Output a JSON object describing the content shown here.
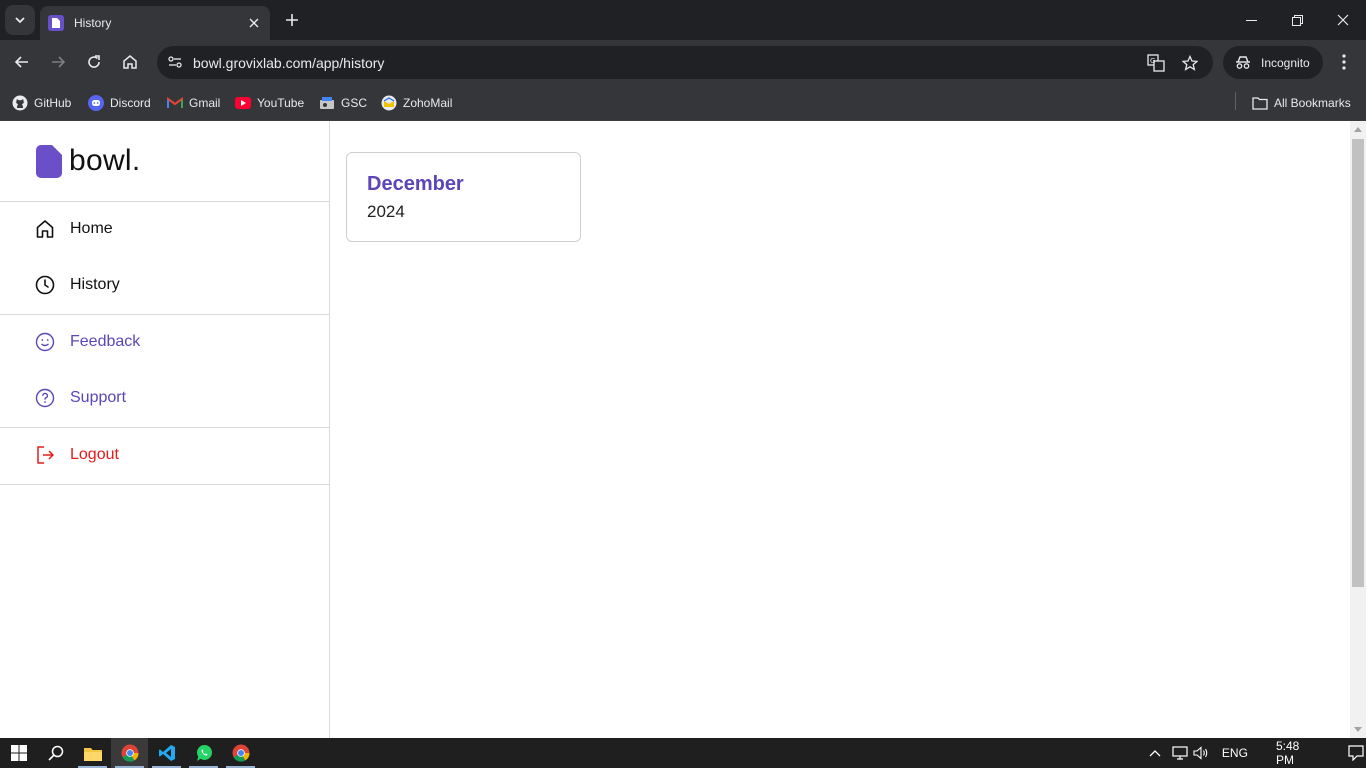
{
  "browser": {
    "tab_title": "History",
    "url": "bowl.grovixlab.com/app/history",
    "incognito_label": "Incognito",
    "bookmarks": [
      {
        "label": "GitHub",
        "icon": "github-icon"
      },
      {
        "label": "Discord",
        "icon": "discord-icon"
      },
      {
        "label": "Gmail",
        "icon": "gmail-icon"
      },
      {
        "label": "YouTube",
        "icon": "youtube-icon"
      },
      {
        "label": "GSC",
        "icon": "gsc-icon"
      },
      {
        "label": "ZohoMail",
        "icon": "zohomail-icon"
      }
    ],
    "all_bookmarks_label": "All Bookmarks"
  },
  "sidebar": {
    "logo_text": "bowl.",
    "items": [
      {
        "label": "Home",
        "icon": "home-icon",
        "color": "#111111"
      },
      {
        "label": "History",
        "icon": "clock-icon",
        "color": "#111111"
      },
      {
        "label": "Feedback",
        "icon": "smile-icon",
        "color": "#5b46b8"
      },
      {
        "label": "Support",
        "icon": "help-circle-icon",
        "color": "#5b46b8"
      },
      {
        "label": "Logout",
        "icon": "logout-icon",
        "color": "#e31b1b"
      }
    ]
  },
  "main": {
    "history_cards": [
      {
        "month": "December",
        "year": "2024"
      }
    ]
  },
  "taskbar": {
    "language": "ENG",
    "time": "5:48 PM"
  },
  "colors": {
    "accent": "#5b46b8",
    "danger": "#e31b1b"
  }
}
